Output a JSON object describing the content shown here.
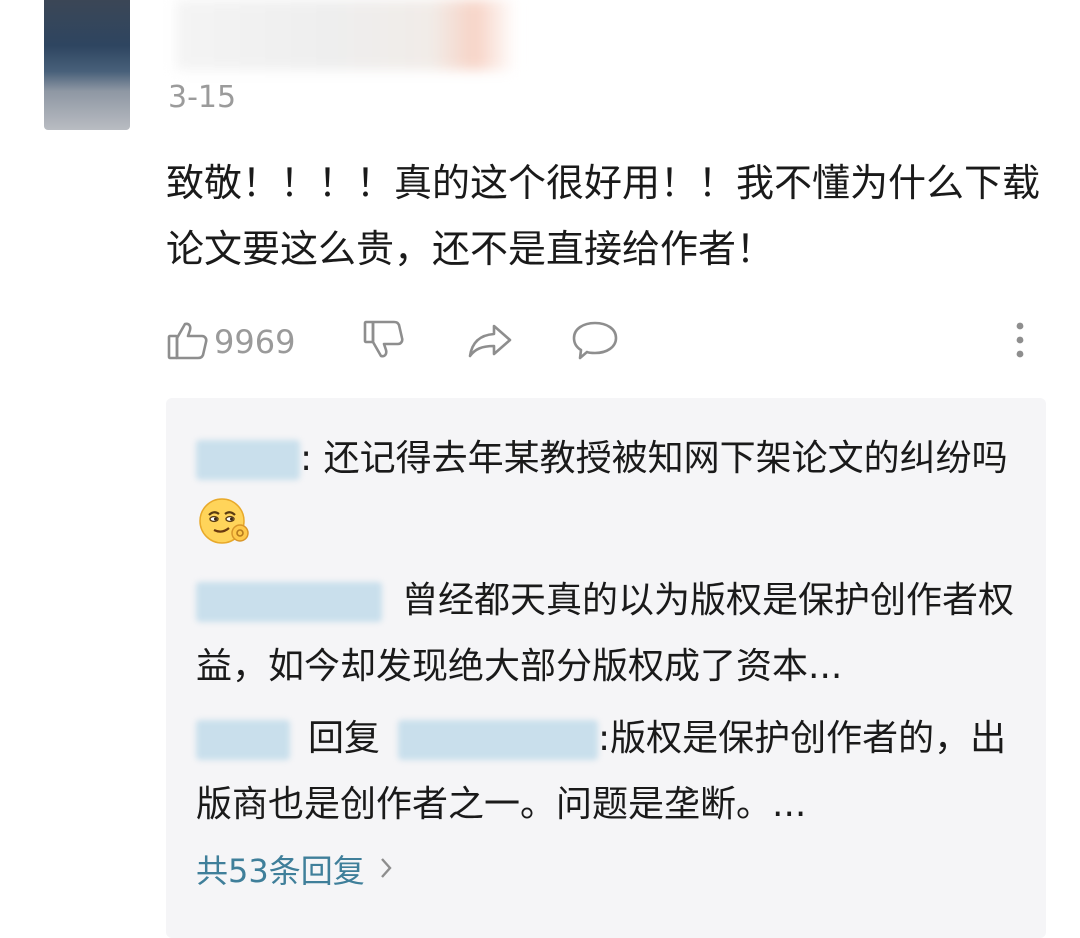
{
  "comment": {
    "date": "3-15",
    "text": "致敬！！！！真的这个很好用！！我不懂为什么下载论文要这么贵，还不是直接给作者！",
    "like_count": "9969"
  },
  "replies": [
    {
      "separator": ": ",
      "text": "还记得去年某教授被知网下架论文的纠纷吗"
    },
    {
      "text": "曾经都天真的以为版权是保护创作者权益，如今却发现绝大部分版权成了资本..."
    },
    {
      "reply_word": "回复",
      "text": ":版权是保护创作者的，出版商也是创作者之一。问题是垄断。..."
    }
  ],
  "footer": {
    "label": "共53条回复"
  },
  "icons": {
    "like": "thumbs-up-icon",
    "dislike": "thumbs-down-icon",
    "share": "share-arrow-icon",
    "reply": "speech-bubble-icon",
    "more": "vertical-dots-icon",
    "emoji": "smirk-ok-emoji"
  },
  "colors": {
    "link": "#3f7f9a",
    "muted": "#9b9b9b",
    "reply_bg": "#f5f5f7"
  }
}
